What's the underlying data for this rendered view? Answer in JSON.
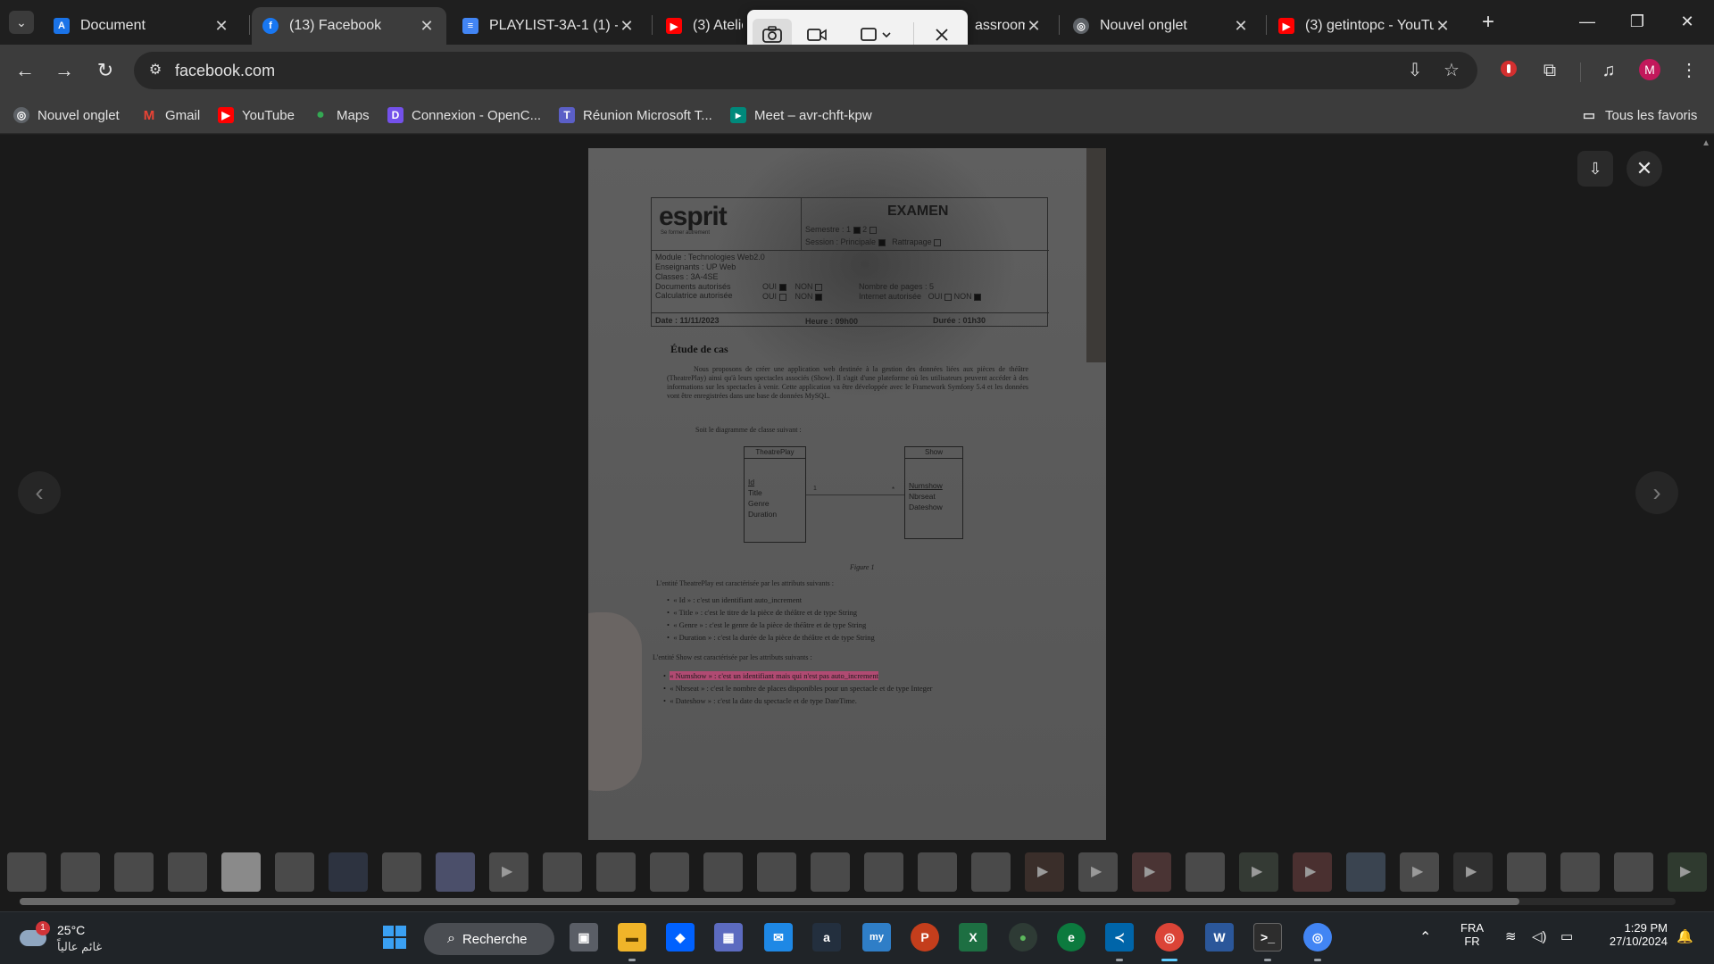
{
  "browser": {
    "tabs": [
      {
        "title": "Document",
        "favicon": "docs-icon",
        "color": "#1a73e8",
        "glyph": "A",
        "active": false
      },
      {
        "title": "(13) Facebook",
        "favicon": "facebook-icon",
        "color": "#1877f2",
        "glyph": "f",
        "active": true
      },
      {
        "title": "PLAYLIST-3A-1 (1) - G",
        "favicon": "google-docs-icon",
        "color": "#4285f4",
        "glyph": "≡",
        "active": false
      },
      {
        "title": "(3) Atelie",
        "favicon": "youtube-icon",
        "color": "#ff0000",
        "glyph": "▶",
        "active": false
      },
      {
        "title": "assroom",
        "favicon": "classroom-icon",
        "color": "#188038",
        "glyph": "",
        "active": false
      },
      {
        "title": "Nouvel onglet",
        "favicon": "chrome-icon",
        "color": "#9aa0a6",
        "glyph": "◎",
        "active": false
      },
      {
        "title": "(3) getintopc - YouTu",
        "favicon": "youtube-icon",
        "color": "#ff0000",
        "glyph": "▶",
        "active": false
      }
    ],
    "url": "facebook.com",
    "bookmarks": [
      {
        "label": "Nouvel onglet",
        "icon": "chrome-icon",
        "color": "#9aa0a6",
        "glyph": "◎"
      },
      {
        "label": "Gmail",
        "icon": "gmail-icon",
        "color": "#ea4335",
        "glyph": "M"
      },
      {
        "label": "YouTube",
        "icon": "youtube-icon",
        "color": "#ff0000",
        "glyph": "▶"
      },
      {
        "label": "Maps",
        "icon": "maps-pin-icon",
        "color": "#34a853",
        "glyph": "●"
      },
      {
        "label": "Connexion - OpenC...",
        "icon": "openclassrooms-icon",
        "color": "#7451eb",
        "glyph": "D"
      },
      {
        "label": "Réunion Microsoft T...",
        "icon": "teams-icon",
        "color": "#5b5fc7",
        "glyph": "T"
      },
      {
        "label": "Meet – avr-chft-kpw",
        "icon": "meet-icon",
        "color": "#00897b",
        "glyph": "▸"
      }
    ],
    "all_bookmarks_label": "Tous les favoris",
    "avatar_letter": "M"
  },
  "document": {
    "logo": "esprit",
    "logo_sub": "Se former autrement",
    "exam_title": "EXAMEN",
    "semestre": "Semestre : 1",
    "semestre_2": "2",
    "session": "Session : Principale",
    "rattrapage": "Rattrapage",
    "module": "Module : Technologies Web2.0",
    "enseignants": "Enseignants : UP Web",
    "classes": "Classes : 3A-4SE",
    "documents": "Documents autorisés",
    "calculatrice": "Calculatrice autorisée",
    "oui": "OUI",
    "non": "NON",
    "nb_pages": "Nombre de pages : 5",
    "internet": "Internet autorisée",
    "date": "Date : 11/11/2023",
    "heure": "Heure : 09h00",
    "duree": "Durée : 01h30",
    "section_title": "Étude de cas",
    "intro": "Nous proposons de créer une application web destinée à la gestion des données liées aux pièces de théâtre (TheatrePlay) ainsi qu'à leurs spectacles associés (Show). Il s'agit d'une plateforme où les utilisateurs peuvent accéder à des informations sur les spectacles à venir. Cette application va être développée avec le Framework Symfony 5.4 et les données vont être enregistrées dans une base de données MySQL.",
    "diagram_intro": "Soit le diagramme de classe suivant :",
    "uml_theatre": {
      "name": "TheatrePlay",
      "attrs": [
        "Id",
        "Title",
        "Genre",
        "Duration"
      ]
    },
    "uml_show": {
      "name": "Show",
      "attrs": [
        "Numshow",
        "Nbrseat",
        "Dateshow"
      ]
    },
    "mult_left": "1",
    "mult_right": "*",
    "figure": "Figure 1",
    "theatre_intro": "L'entité TheatrePlay est caractérisée par les attributs suivants :",
    "theatre_attrs": [
      "« Id » : c'est un identifiant auto_increment",
      "« Title » : c'est le titre de la pièce de théâtre et de type String",
      "« Genre » : c'est le genre de la pièce de théâtre et de type String",
      "« Duration » : c'est la durée de la pièce de théâtre et de type String"
    ],
    "show_intro": "L'entité Show est caractérisée par les attributs suivants :",
    "show_attrs": [
      "« Numshow » : c'est un identifiant mais qui n'est pas auto_increment",
      "« Nbrseat » : c'est le nombre de places disponibles pour un spectacle et de type Integer",
      "« Dateshow » : c'est la date du spectacle et de type DateTime."
    ]
  },
  "taskbar": {
    "temperature": "25°C",
    "weather_desc": "غائم عالياً",
    "weather_badge": "1",
    "search_label": "Recherche",
    "lang_top": "FRA",
    "lang_bottom": "FR",
    "time": "1:29 PM",
    "date": "27/10/2024"
  }
}
